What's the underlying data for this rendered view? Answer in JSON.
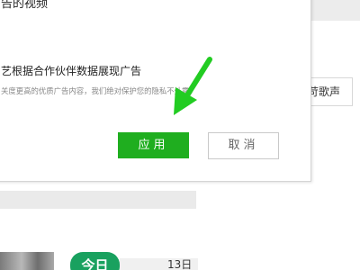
{
  "dialog": {
    "title": "告的视频",
    "option_label": "艺根据合作伙伴数据展现广告",
    "option_description": "关度更高的优质广告内容，我们绝对保护您的隐私不外露。",
    "apply_label": "应用",
    "cancel_label": "取消"
  },
  "background": {
    "lyrics_button_label": "苛歌声",
    "today_badge": "今日",
    "date_text": "13日"
  },
  "annotation": {
    "arrow_icon": "green-arrow-icon",
    "color": "#22cc22"
  },
  "colors": {
    "apply_button": "#1fae1f",
    "today_badge": "#19a15f"
  }
}
